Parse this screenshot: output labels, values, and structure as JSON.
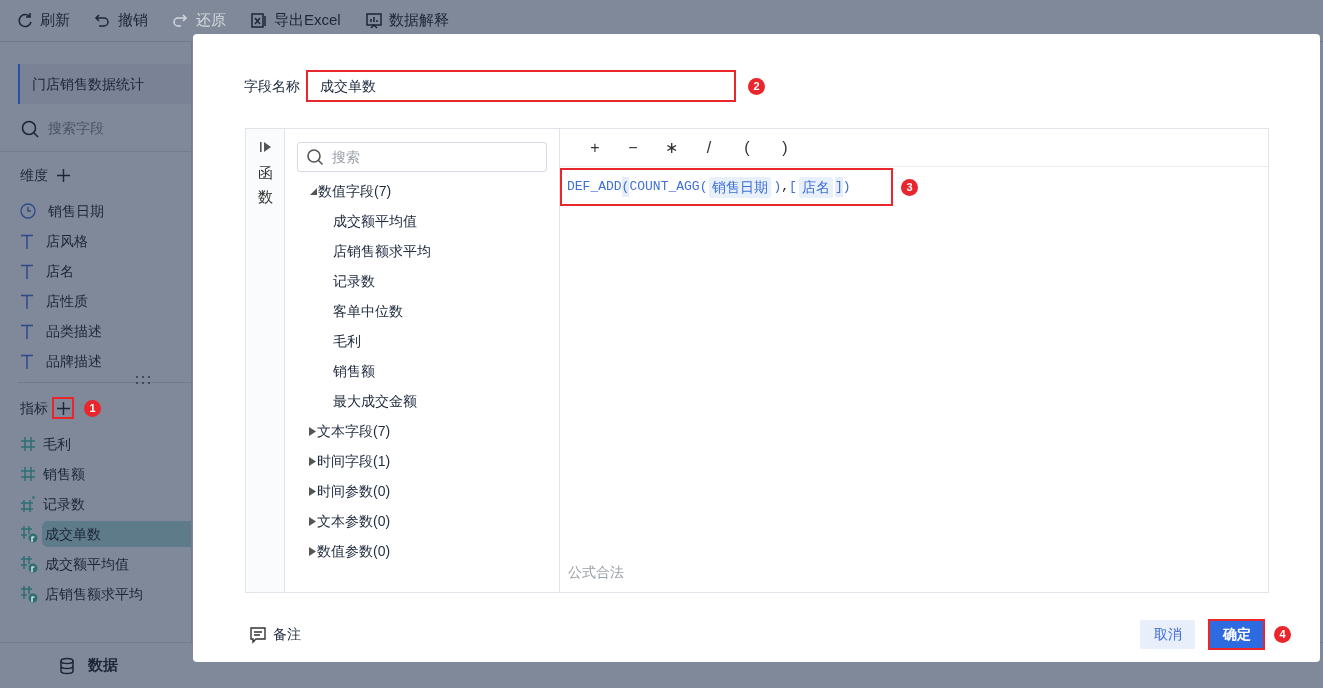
{
  "toolbar": [
    {
      "label": "刷新",
      "disabled": false
    },
    {
      "label": "撤销",
      "disabled": false
    },
    {
      "label": "还原",
      "disabled": true
    },
    {
      "label": "导出Excel",
      "disabled": false
    },
    {
      "label": "数据解释",
      "disabled": false
    }
  ],
  "sidebar": {
    "title": "门店销售数据统计",
    "search_placeholder": "搜索字段",
    "dimensions": {
      "label": "维度",
      "items": [
        {
          "label": "销售日期",
          "kind": "date"
        },
        {
          "label": "店风格",
          "kind": "text"
        },
        {
          "label": "店名",
          "kind": "text"
        },
        {
          "label": "店性质",
          "kind": "text"
        },
        {
          "label": "品类描述",
          "kind": "text"
        },
        {
          "label": "品牌描述",
          "kind": "text"
        }
      ]
    },
    "measures": {
      "label": "指标",
      "badge": "1",
      "items": [
        {
          "label": "毛利",
          "kind": "number",
          "selected": false
        },
        {
          "label": "销售额",
          "kind": "number",
          "selected": false
        },
        {
          "label": "记录数",
          "kind": "record",
          "selected": false
        },
        {
          "label": "成交单数",
          "kind": "calc",
          "selected": true
        },
        {
          "label": "成交额平均值",
          "kind": "calc",
          "selected": false
        },
        {
          "label": "店销售额求平均",
          "kind": "calc",
          "selected": false
        }
      ]
    }
  },
  "bottom_tab": {
    "label": "数据"
  },
  "dialog": {
    "field_name": {
      "label": "字段名称",
      "value": "成交单数",
      "badge": "2"
    },
    "functions_tab": "函数",
    "search_placeholder": "搜索",
    "tree": [
      {
        "label": "数值字段(7)",
        "expanded": true,
        "children": [
          {
            "label": "成交额平均值"
          },
          {
            "label": "店销售额求平均"
          },
          {
            "label": "记录数"
          },
          {
            "label": "客单中位数"
          },
          {
            "label": "毛利"
          },
          {
            "label": "销售额"
          },
          {
            "label": "最大成交金额"
          }
        ]
      },
      {
        "label": "文本字段(7)",
        "expanded": false
      },
      {
        "label": "时间字段(1)",
        "expanded": false
      },
      {
        "label": "时间参数(0)",
        "expanded": false
      },
      {
        "label": "文本参数(0)",
        "expanded": false
      },
      {
        "label": "数值参数(0)",
        "expanded": false
      }
    ],
    "operators": [
      "+",
      "−",
      "∗",
      "/",
      "(",
      ")"
    ],
    "formula": {
      "badge": "3",
      "tokens": [
        {
          "text": "DEF_ADD",
          "kind": "code"
        },
        {
          "text": "(",
          "kind": "paren"
        },
        {
          "text": "COUNT_AGG(",
          "kind": "code"
        },
        {
          "text": "销售日期",
          "kind": "field"
        },
        {
          "text": ")",
          "kind": "code"
        },
        {
          "text": ",",
          "kind": "plain"
        },
        {
          "text": "[",
          "kind": "code"
        },
        {
          "text": "店名",
          "kind": "field"
        },
        {
          "text": "]",
          "kind": "paren"
        },
        {
          "text": ")",
          "kind": "code"
        }
      ]
    },
    "status": "公式合法",
    "note_button": "备注",
    "cancel_button": "取消",
    "confirm_button": {
      "label": "确定",
      "badge": "4"
    }
  }
}
